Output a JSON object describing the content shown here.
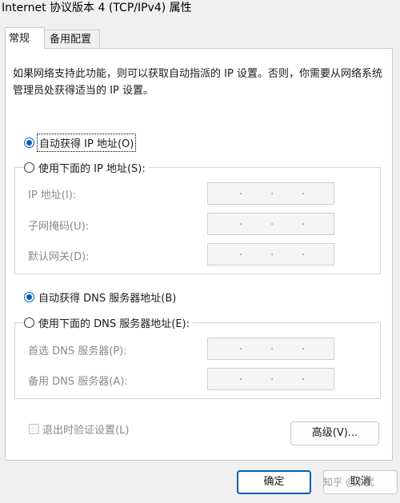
{
  "window": {
    "title": "Internet 协议版本 4 (TCP/IPv4) 属性"
  },
  "tabs": [
    {
      "label": "常规"
    },
    {
      "label": "备用配置"
    }
  ],
  "description": "如果网络支持此功能，则可以获取自动指派的 IP 设置。否则，你需要从网络系统管理员处获得适当的 IP 设置。",
  "ip_section": {
    "auto_label": "自动获得 IP 地址(O)",
    "manual_label": "使用下面的 IP 地址(S):",
    "selected": "auto",
    "fields": [
      {
        "label": "IP 地址(I):"
      },
      {
        "label": "子网掩码(U):"
      },
      {
        "label": "默认网关(D):"
      }
    ]
  },
  "dns_section": {
    "auto_label": "自动获得 DNS 服务器地址(B)",
    "manual_label": "使用下面的 DNS 服务器地址(E):",
    "selected": "auto",
    "fields": [
      {
        "label": "首选 DNS 服务器(P):"
      },
      {
        "label": "备用 DNS 服务器(A):"
      }
    ]
  },
  "validate": {
    "label": "退出时验证设置(L)",
    "checked": false
  },
  "buttons": {
    "advanced": "高级(V)...",
    "ok": "确定",
    "cancel": "取消"
  },
  "ip_separator": ".",
  "watermark": "知乎 @小武",
  "colors": {
    "accent": "#005fb8",
    "disabled_text": "#8a8a8a"
  }
}
